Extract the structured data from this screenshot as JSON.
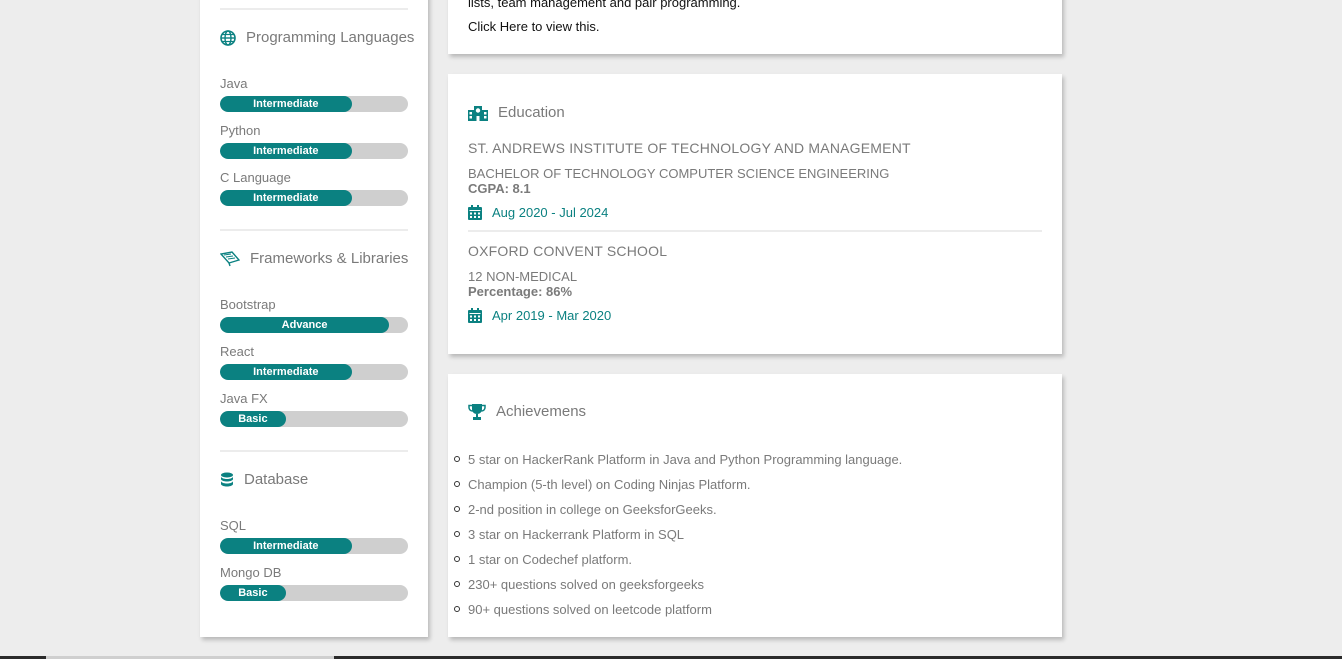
{
  "skills": {
    "sections": [
      {
        "title": "Programming Languages",
        "icon": "globe-icon",
        "items": [
          {
            "name": "Java",
            "level": "Intermediate",
            "fraction": 0.7
          },
          {
            "name": "Python",
            "level": "Intermediate",
            "fraction": 0.7
          },
          {
            "name": "C Language",
            "level": "Intermediate",
            "fraction": 0.7
          }
        ]
      },
      {
        "title": "Frameworks & Libraries",
        "icon": "book-icon",
        "items": [
          {
            "name": "Bootstrap",
            "level": "Advance",
            "fraction": 0.9
          },
          {
            "name": "React",
            "level": "Intermediate",
            "fraction": 0.7
          },
          {
            "name": "Java FX",
            "level": "Basic",
            "fraction": 0.35
          }
        ]
      },
      {
        "title": "Database",
        "icon": "database-icon",
        "items": [
          {
            "name": "SQL",
            "level": "Intermediate",
            "fraction": 0.7
          },
          {
            "name": "Mongo DB",
            "level": "Basic",
            "fraction": 0.35
          }
        ]
      }
    ]
  },
  "project": {
    "text_line": "lists, team management and pair programming.",
    "link_text": "Click Here to view this."
  },
  "education": {
    "title": "Education",
    "entries": [
      {
        "school": "ST. ANDREWS INSTITUTE OF TECHNOLOGY AND MANAGEMENT",
        "degree": "BACHELOR OF TECHNOLOGY COMPUTER SCIENCE ENGINEERING",
        "score": "CGPA: 8.1",
        "dates": "Aug 2020 - Jul 2024"
      },
      {
        "school": "OXFORD CONVENT SCHOOL",
        "degree": "12 NON-MEDICAL",
        "score": "Percentage: 86%",
        "dates": "Apr 2019 - Mar 2020"
      }
    ]
  },
  "achievements": {
    "title": "Achievemens",
    "items": [
      "5 star on HackerRank Platform in Java and Python Programming language.",
      "Champion (5-th level) on Coding Ninjas Platform.",
      "2-nd position in college on GeeksforGeeks.",
      "3 star on Hackerrank Platform in SQL",
      "1 star on Codechef platform.",
      "230+ questions solved on geeksforgeeks",
      "90+ questions solved on leetcode platform"
    ]
  },
  "colors": {
    "accent": "#0b8181",
    "bar_track": "#cfcfcf",
    "background": "#ededed"
  }
}
